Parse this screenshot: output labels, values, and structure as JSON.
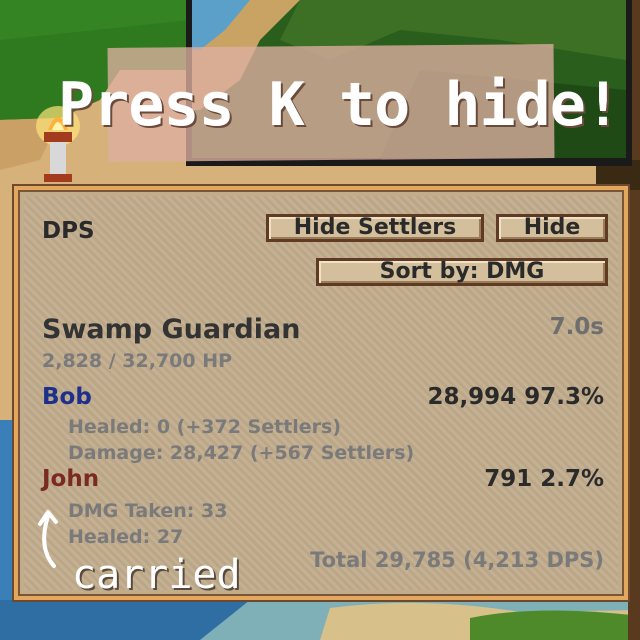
{
  "overlay": {
    "press_k": "Press K to hide!",
    "carried": "carried"
  },
  "panel": {
    "title": "DPS",
    "buttons": {
      "hide_settlers": "Hide Settlers",
      "hide": "Hide",
      "sort": "Sort by: DMG"
    },
    "boss": {
      "name": "Swamp Guardian",
      "time": "7.0s",
      "hp": "2,828 / 32,700 HP"
    },
    "players": [
      {
        "name": "Bob",
        "color": "#1f2f8c",
        "stat": "28,994 97.3%",
        "details": [
          "Healed: 0 (+372 Settlers)",
          "Damage: 28,427 (+567 Settlers)"
        ]
      },
      {
        "name": "John",
        "color": "#7a2a22",
        "stat": "791 2.7%",
        "details": [
          "DMG Taken: 33",
          "Healed: 27"
        ]
      }
    ],
    "total": "Total 29,785 (4,213 DPS)"
  },
  "icons": {
    "torch": "torch-icon",
    "arrow": "curved-arrow-icon"
  }
}
